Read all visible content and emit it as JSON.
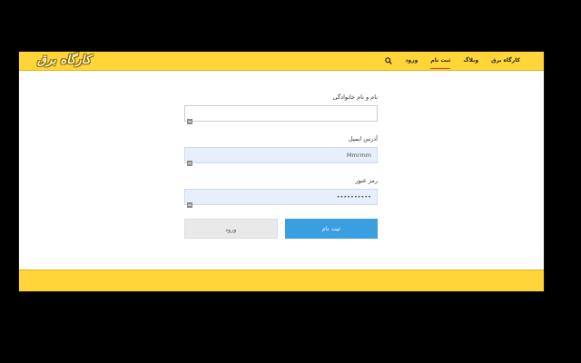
{
  "header": {
    "logo_text": "کارگاه برق",
    "nav": [
      {
        "label": "کارگاه برق"
      },
      {
        "label": "وبلاگ"
      },
      {
        "label": "ثبت نام"
      },
      {
        "label": "ورود"
      }
    ],
    "search_icon": "search-icon"
  },
  "form": {
    "fullname": {
      "label": "نام و نام خانوادگی",
      "value": ""
    },
    "email": {
      "label": "آدرس ایمیل",
      "value": "Mmrmm"
    },
    "password": {
      "label": "رمز عبور",
      "value": "••••••••••"
    },
    "register_button": "ثبت نام",
    "login_button": "ورود"
  },
  "colors": {
    "brand_yellow": "#ffd53a",
    "primary_blue": "#3a9fe0",
    "active_underline": "#d24a2a"
  }
}
